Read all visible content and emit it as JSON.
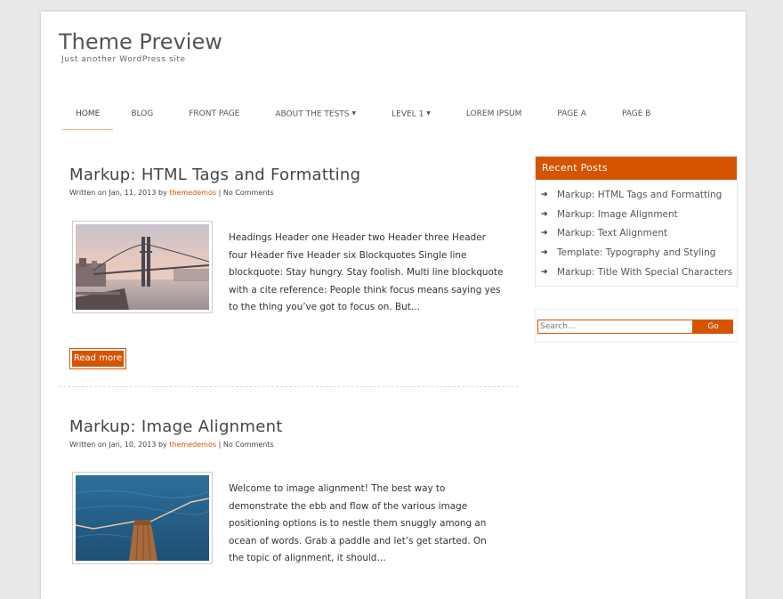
{
  "site": {
    "title": "Theme Preview",
    "description": "Just another WordPress site"
  },
  "nav": {
    "items": [
      {
        "label": "HOME",
        "active": true
      },
      {
        "label": "BLOG"
      },
      {
        "label": "FRONT PAGE"
      },
      {
        "label": "ABOUT THE TESTS",
        "dropdown": true
      },
      {
        "label": "LEVEL 1",
        "dropdown": true
      },
      {
        "label": "LOREM IPSUM"
      },
      {
        "label": "PAGE A"
      },
      {
        "label": "PAGE B"
      }
    ]
  },
  "posts": [
    {
      "title": "Markup: HTML Tags and Formatting",
      "meta_prefix": "Written on Jan, 11, 2013 by",
      "author": "themedemos",
      "separator": "|",
      "comments": "No Comments",
      "excerpt": "Headings Header one Header two Header three Header four Header five Header six Blockquotes Single line blockquote: Stay hungry. Stay foolish. Multi line blockquote with a cite reference: People think focus means saying yes to the thing you’ve got to focus on. But…",
      "read_more": "Read more",
      "image_icon": "bridge-photo"
    },
    {
      "title": "Markup: Image Alignment",
      "meta_prefix": "Written on Jan, 10, 2013 by",
      "author": "themedemos",
      "separator": "|",
      "comments": "No Comments",
      "excerpt": "Welcome to image alignment! The best way to demonstrate the ebb and flow of the various image positioning options is to nestle them snuggly among an ocean of words. Grab a paddle and let’s get started. On the topic of alignment, it should…",
      "image_icon": "dock-ocean-photo"
    }
  ],
  "sidebar": {
    "recent_posts_title": "Recent Posts",
    "recent_posts": [
      "Markup: HTML Tags and Formatting",
      "Markup: Image Alignment",
      "Markup: Text Alignment",
      "Template: Typography and Styling",
      "Markup: Title With Special Characters"
    ],
    "search_placeholder": "Search...",
    "search_button": "Go"
  },
  "colors": {
    "accent": "#d55400",
    "background": "#e9e9e9"
  }
}
